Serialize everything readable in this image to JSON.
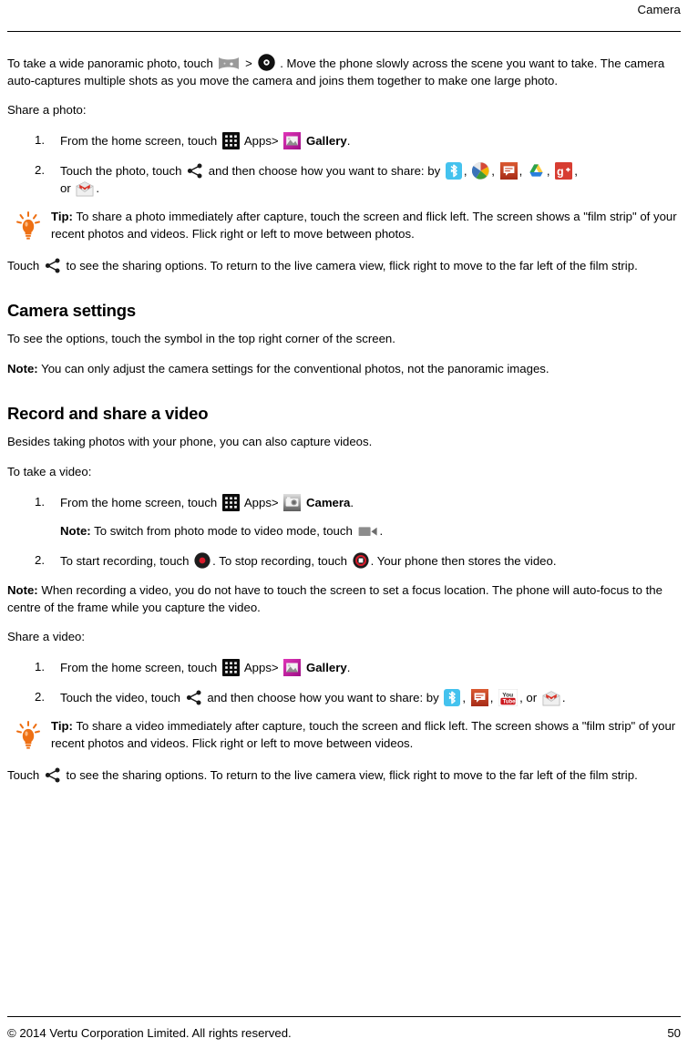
{
  "header": {
    "chapter_title": "Camera"
  },
  "body": {
    "panorama_para_1": "To take a wide panoramic photo, touch",
    "panorama_sep": ">",
    "panorama_para_2": ". Move the phone slowly across the scene you want to take. The camera auto-captures multiple shots as you move the camera and joins them together to make one large photo.",
    "share_photo_intro": "Share a photo:",
    "photo_steps": [
      {
        "number": "1.",
        "text_before_apps_icon": "From the home screen, touch",
        "apps_label": "Apps",
        "separator": ">",
        "app_name": "Gallery",
        "text_after": "."
      },
      {
        "number": "2.",
        "text_before_share_icon": "Touch the photo, touch",
        "text_after_share_icon": "and then choose how you want to share: by",
        "comma": ",",
        "or_word": "or",
        "period": "."
      }
    ],
    "photo_share_icons": [
      "bluetooth-icon",
      "picasa-icon",
      "messaging-icon",
      "google-drive-icon",
      "google-plus-icon",
      "gmail-icon"
    ],
    "tip_photo": {
      "label": "Tip:",
      "text": "To share a photo immediately after capture, touch the screen and flick left. The screen shows a \"film strip\" of your recent photos and videos. Flick right or left to move between photos."
    },
    "touch_share_photo_1": "Touch",
    "touch_share_photo_2": "to see the sharing options. To return to the live camera view, flick right to move to the far left of the film strip.",
    "camera_settings": {
      "heading": "Camera settings",
      "para": "To see the options, touch the symbol in the top right corner of the screen.",
      "note_label": "Note:",
      "note_text": "You can only adjust the camera settings for the conventional photos, not the panoramic images."
    },
    "record_share_video": {
      "heading": "Record and share a video",
      "intro": "Besides taking photos with your phone, you can also capture videos.",
      "take_video_intro": "To take a video:"
    },
    "video_steps": [
      {
        "number": "1.",
        "text_before_apps_icon": "From the home screen, touch",
        "apps_label": "Apps",
        "separator": ">",
        "app_name": "Camera",
        "text_after": ".",
        "note_label": "Note:",
        "note_text_before": "To switch from photo mode to video mode, touch",
        "note_text_after": "."
      },
      {
        "number": "2.",
        "text_1": "To start recording, touch",
        "text_2": ". To stop recording, touch",
        "text_3": ". Your phone then stores the video."
      }
    ],
    "note_recording": {
      "label": "Note:",
      "text": "When recording a video, you do not have to touch the screen to set a focus location. The phone will auto-focus to the centre of the frame while you capture the video."
    },
    "share_video_intro": "Share a video:",
    "video_share_steps": [
      {
        "number": "1.",
        "text_before_apps_icon": "From the home screen, touch",
        "apps_label": "Apps",
        "separator": ">",
        "app_name": "Gallery",
        "text_after": "."
      },
      {
        "number": "2.",
        "text_before_share_icon": "Touch the video, touch",
        "text_after_share_icon": "and then choose how you want to share: by",
        "comma": ",",
        "or_word": ", or",
        "period": "."
      }
    ],
    "video_share_icons": [
      "bluetooth-icon",
      "messaging-icon",
      "youtube-icon",
      "gmail-icon"
    ],
    "tip_video": {
      "label": "Tip:",
      "text": "To share a video immediately after capture, touch the screen and flick left. The screen shows a \"film strip\" of your recent photos and videos. Flick right or left to move between videos."
    },
    "touch_share_video_1": "Touch",
    "touch_share_video_2": "to see the sharing options. To return to the live camera view, flick right to move to the far left of the film strip."
  },
  "footer": {
    "copyright": "© 2014 Vertu Corporation Limited. All rights reserved.",
    "page_number": "50"
  },
  "colors": {
    "bluetooth": "#2cb8e8",
    "messaging": "#c8331c",
    "google_plus": "#d73d32",
    "drive_blue": "#2a7fdd",
    "drive_green": "#2ba24c",
    "drive_yellow": "#ffcd40",
    "gallery_magenta": "#cc24a0",
    "youtube_red": "#cc181e",
    "gmail_red": "#d93025",
    "tip_orange": "#ee7014",
    "record_red": "#d91b2b"
  }
}
